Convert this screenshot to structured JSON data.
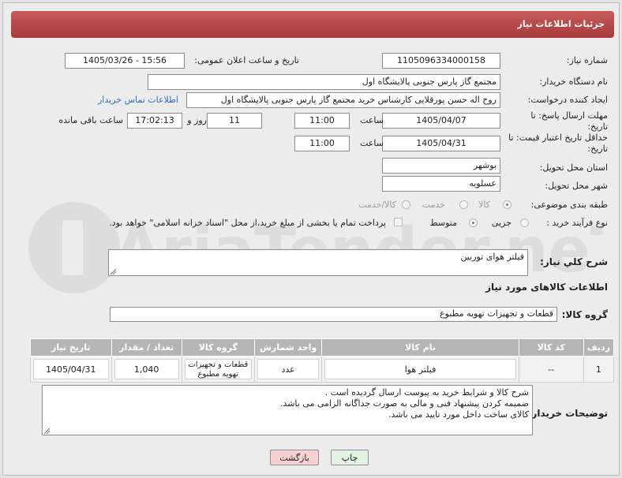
{
  "header": {
    "title": "جزئیات اطلاعات نیاز"
  },
  "fields": {
    "need_number_label": "شماره نیاز:",
    "need_number": "1105096334000158",
    "announce_label": "تاریخ و ساعت اعلان عمومی:",
    "announce_value": "1405/03/26 - 15:56",
    "buyer_org_label": "نام دستگاه خریدار:",
    "buyer_org": "مجتمع گاز پارس جنوبی  پالایشگاه اول",
    "requester_label": "ایجاد کننده درخواست:",
    "requester": "روح اله حسن پورقلایی کارشناس خرید مجتمع گاز پارس جنوبی  پالایشگاه اول",
    "buyer_contact_link": "اطلاعات تماس خریدار",
    "deadline_label": "مهلت ارسال پاسخ: تا تاریخ:",
    "deadline_date": "1405/04/07",
    "time_label": "ساعت",
    "deadline_time": "11:00",
    "days_value": "11",
    "days_label": "روز و",
    "remaining_time": "17:02:13",
    "remaining_label": "ساعت باقی مانده",
    "min_price_label": "حداقل تاریخ اعتبار قیمت: تا تاریخ:",
    "min_price_date": "1405/04/31",
    "min_price_time": "11:00",
    "province_label": "استان محل تحویل:",
    "province": "بوشهر",
    "city_label": "شهر محل تحویل:",
    "city": "عسلویه",
    "category_label": "طبقه بندی موضوعی:",
    "category_options": [
      "کالا",
      "خدمت",
      "کالا/خدمت"
    ],
    "process_label": "نوع فرآیند خرید :",
    "process_options": [
      "جزیی",
      "متوسط"
    ],
    "payment_note": "پرداخت تمام یا بخشی از مبلغ خرید،از محل \"اسناد خزانه اسلامی\" خواهد بود."
  },
  "summary": {
    "label": "شرح کلي نياز:",
    "value": "فیلتر هوای توربین"
  },
  "goods_section": {
    "title": "اطلاعات کالاهای مورد نیاز",
    "group_label": "گروه کالا:",
    "group_value": "قطعات و تجهیزات تهویه مطبوع"
  },
  "table": {
    "headers": [
      "ردیف",
      "کد کالا",
      "نام کالا",
      "واحد شمارش",
      "گروه کالا",
      "تعداد / مقدار",
      "تاریخ نیاز"
    ],
    "rows": [
      [
        "1",
        "--",
        "فیلتر هوا",
        "عدد",
        "قطعات و تجهیزات تهویه مطبوع",
        "1,040",
        "1405/04/31"
      ]
    ]
  },
  "buyer_notes": {
    "label": "توضیحات خریدار:",
    "lines": [
      "شرح کالا و شرایط خرید به پیوست ارسال گردیده است .",
      "ضمیمه کردن پیشنهاد فنی و مالی به صورت جداگانه الزامی می باشد.",
      "کالای ساخت داخل مورد تایید می باشد."
    ]
  },
  "buttons": {
    "print": "چاپ",
    "back": "بازگشت"
  },
  "watermark": {
    "text": "AriaTender.neT"
  },
  "colors": {
    "header": "#b44a4a",
    "link": "#2a6ebd",
    "back_button": "#f7d2d2",
    "print_button": "#e2f3e2"
  }
}
